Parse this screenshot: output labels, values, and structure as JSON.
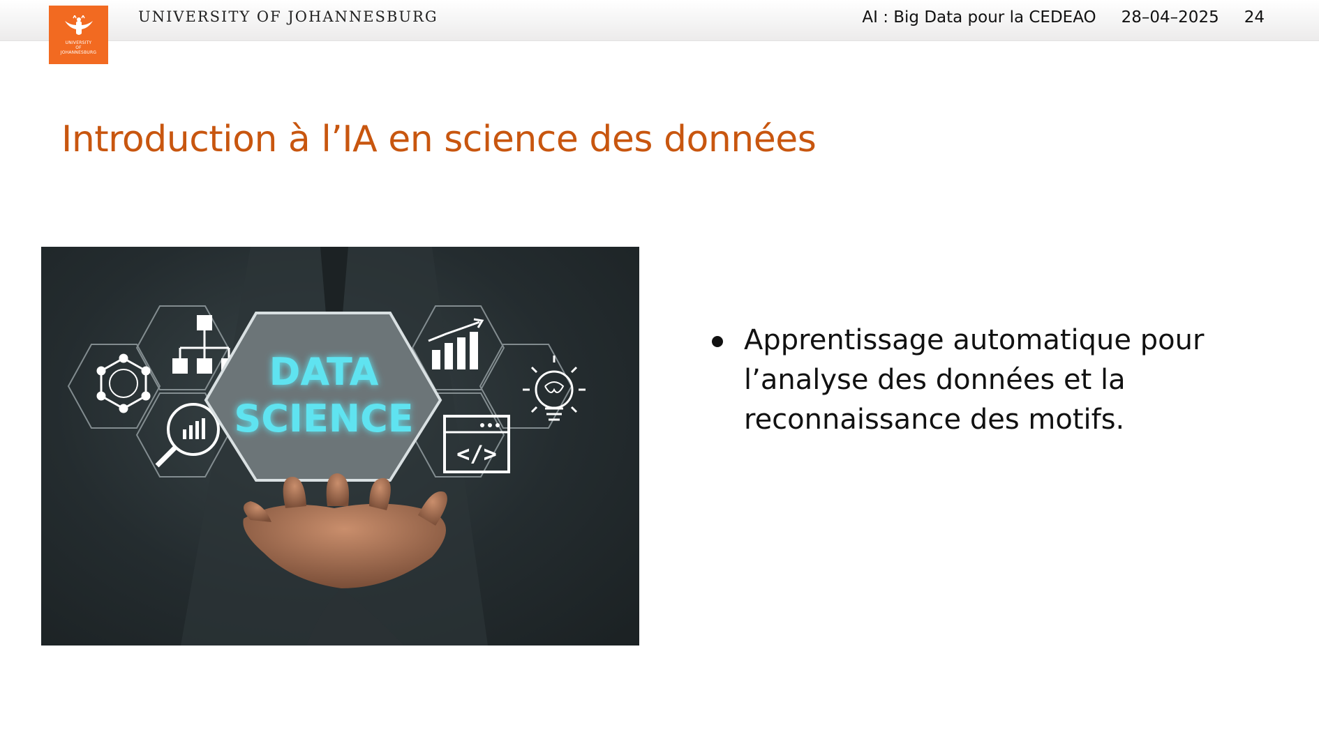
{
  "header": {
    "logo_text_lines": [
      "UNIVERSITY",
      "OF",
      "JOHANNESBURG"
    ],
    "institution": "UNIVERSITY OF JOHANNESBURG",
    "course": "AI : Big Data pour la CEDEAO",
    "date": "28–04–2025",
    "page_number": "24"
  },
  "slide": {
    "title": "Introduction à l’IA en science des données",
    "image": {
      "label_line1": "DATA",
      "label_line2": "SCIENCE",
      "code_symbol": "</>"
    },
    "bullets": [
      "Apprentissage automatique pour l’analyse des données et la reconnaissance des motifs."
    ]
  },
  "colors": {
    "logo_orange": "#f26a21",
    "title_orange": "#c8560f",
    "photo_background": "#242c2f",
    "glow_cyan": "#5fe3f0"
  }
}
